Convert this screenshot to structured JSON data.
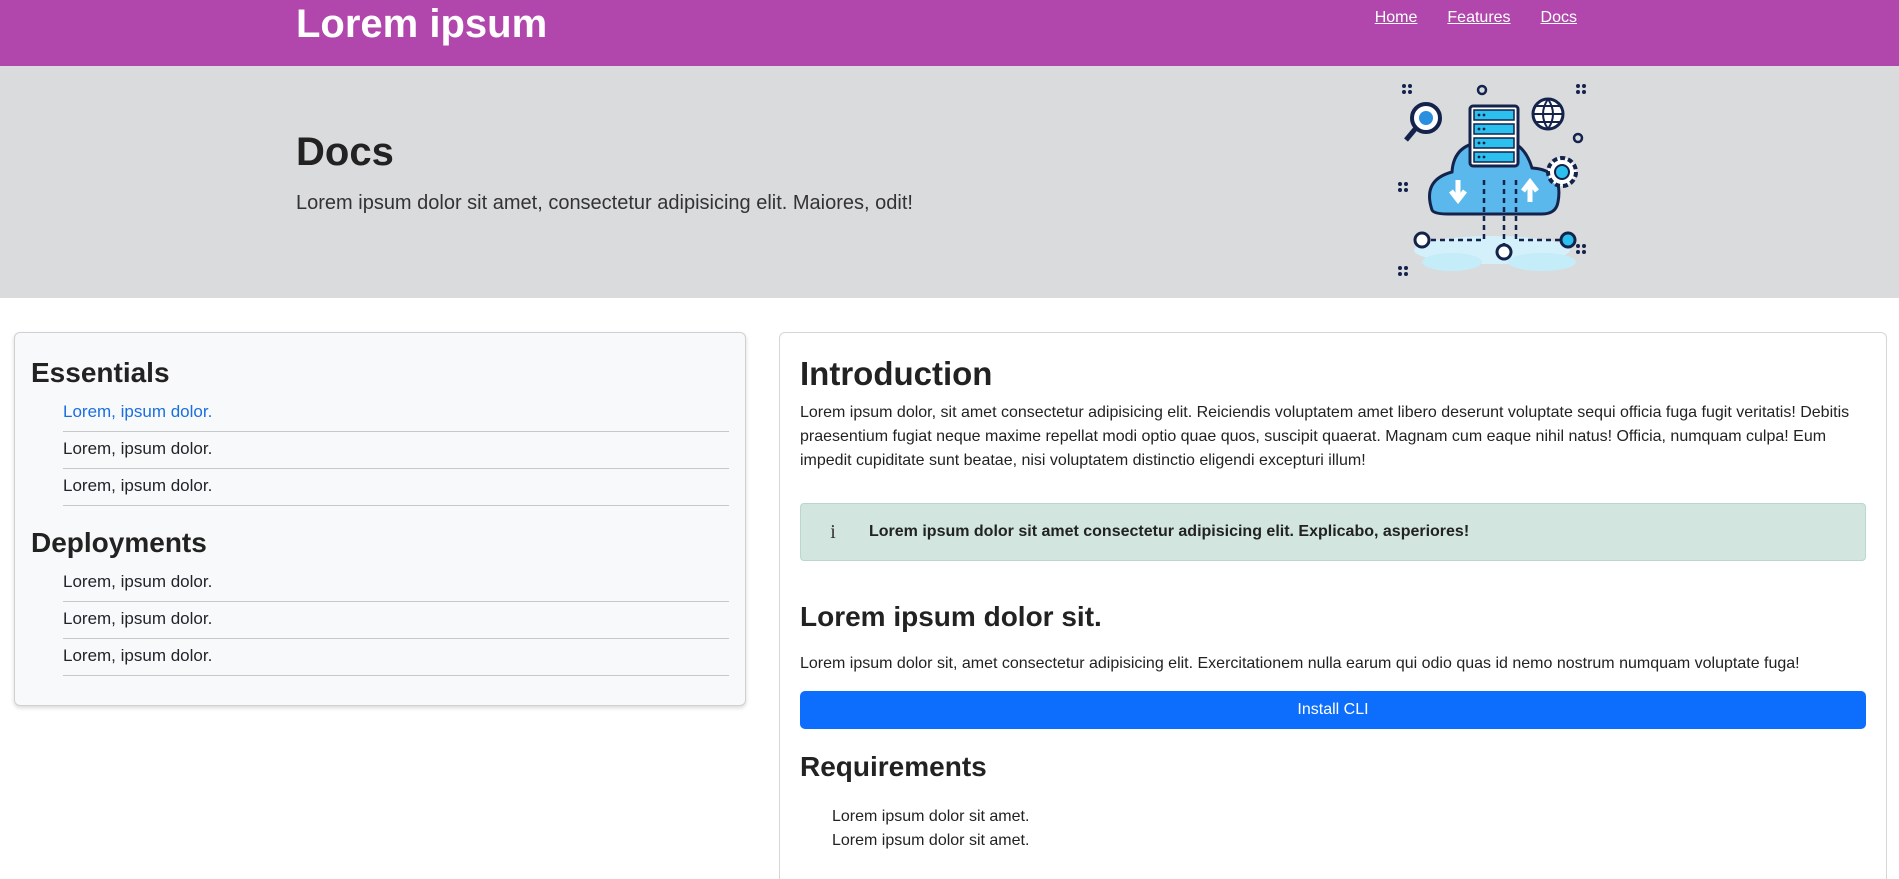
{
  "header": {
    "brand": "Lorem ipsum",
    "nav": [
      "Home",
      "Features",
      "Docs"
    ],
    "color": "#b146ad"
  },
  "hero": {
    "title": "Docs",
    "subtitle": "Lorem ipsum dolor sit amet, consectetur adipisicing elit. Maiores, odit!",
    "illustration_icon": "cloud-server-icon"
  },
  "sidebar": {
    "sections": [
      {
        "heading": "Essentials",
        "items": [
          "Lorem, ipsum dolor.",
          "Lorem, ipsum dolor.",
          "Lorem, ipsum dolor."
        ]
      },
      {
        "heading": "Deployments",
        "items": [
          "Lorem, ipsum dolor.",
          "Lorem, ipsum dolor.",
          "Lorem, ipsum dolor."
        ]
      }
    ],
    "active_color": "#1a6fe0"
  },
  "main": {
    "title": "Introduction",
    "intro": "Lorem ipsum dolor, sit amet consectetur adipisicing elit. Reiciendis voluptatem amet libero deserunt voluptate sequi officia fuga fugit veritatis! Debitis praesentium fugiat neque maxime repellat modi optio quae quos, suscipit quaerat. Magnam cum eaque nihil natus! Officia, numquam culpa! Eum impedit cupiditate sunt beatae, nisi voluptatem distinctio eligendi excepturi illum!",
    "alert": {
      "icon": "info-icon",
      "glyph": "i",
      "text": "Lorem ipsum dolor sit amet consectetur adipisicing elit. Explicabo, asperiores!"
    },
    "section_title": "Lorem ipsum dolor sit.",
    "section_text": "Lorem ipsum dolor sit, amet consectetur adipisicing elit. Exercitationem nulla earum qui odio quas id nemo nostrum numquam voluptate fuga!",
    "button_label": "Install CLI",
    "button_color": "#0d6efd",
    "requirements_title": "Requirements",
    "requirements": [
      "Lorem ipsum dolor sit amet.",
      "Lorem ipsum dolor sit amet."
    ]
  }
}
